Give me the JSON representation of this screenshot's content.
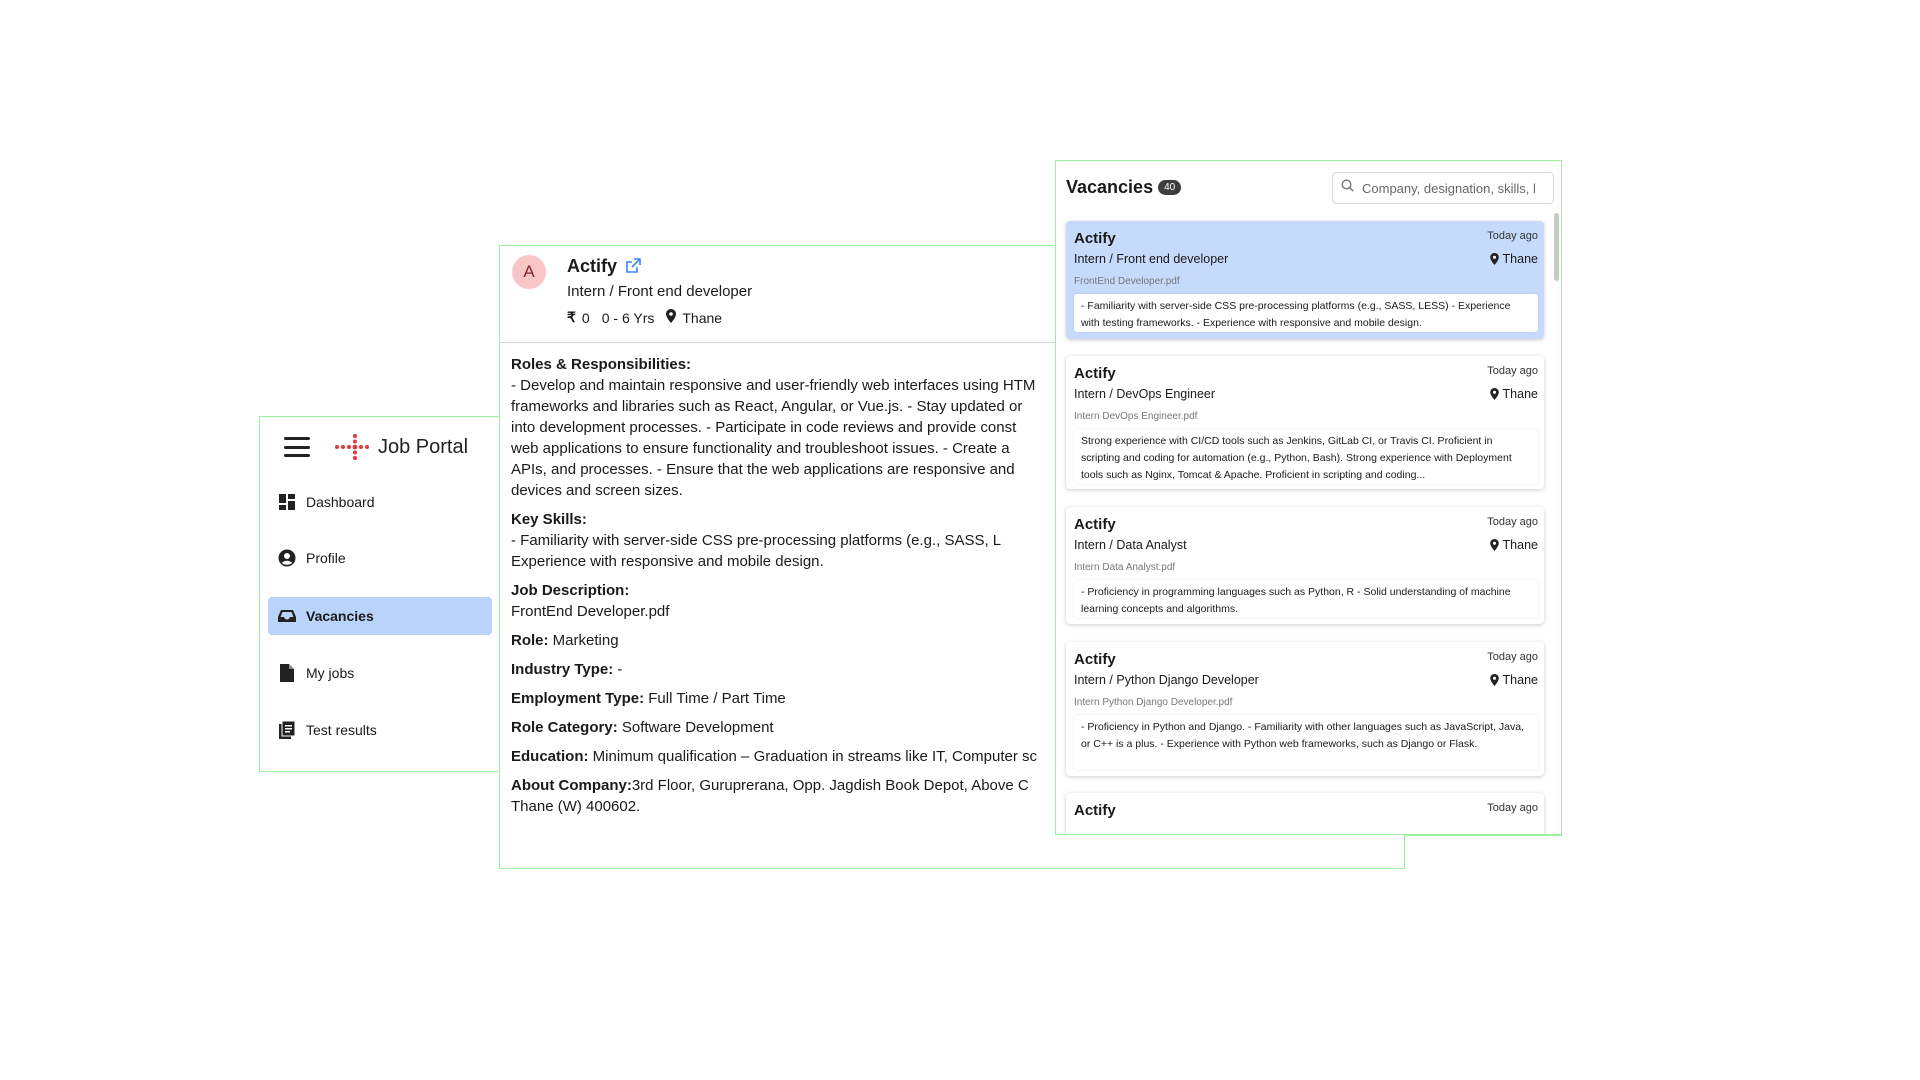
{
  "sidebar": {
    "app_title": "Job Portal",
    "items": [
      {
        "label": "Dashboard",
        "icon": "dashboard-icon"
      },
      {
        "label": "Profile",
        "icon": "account-circle-icon"
      },
      {
        "label": "Vacancies",
        "icon": "inbox-icon",
        "active": true
      },
      {
        "label": "My jobs",
        "icon": "document-icon"
      },
      {
        "label": "Test results",
        "icon": "clipboard-icon"
      }
    ]
  },
  "detail": {
    "avatar_letter": "A",
    "company": "Actify",
    "role": "Intern / Front end developer",
    "salary": "0",
    "experience": "0 - 6 Yrs",
    "location": "Thane",
    "roles_heading": "Roles & Responsibilities:",
    "roles_lines": [
      "- Develop and maintain responsive and user-friendly web interfaces using HTM",
      "frameworks and libraries such as React, Angular, or Vue.js. - Stay updated or",
      "into development processes. - Participate in code reviews and provide const",
      "web applications to ensure functionality and troubleshoot issues. - Create a",
      "APIs, and processes. - Ensure that the web applications are responsive and",
      "devices and screen sizes."
    ],
    "skills_heading": "Key Skills:",
    "skills_lines": [
      "- Familiarity with server-side CSS pre-processing platforms (e.g., SASS, L",
      "Experience with responsive and mobile design."
    ],
    "jd_heading": "Job Description:",
    "jd_file": "FrontEnd Developer.pdf",
    "role_label": "Role:",
    "role_value": "Marketing",
    "industry_label": "Industry Type:",
    "industry_value": "-",
    "employment_label": "Employment Type:",
    "employment_value": "Full Time / Part Time",
    "category_label": "Role Category:",
    "category_value": "Software Development",
    "education_label": "Education:",
    "education_value": "Minimum qualification – Graduation in streams like IT, Computer sc",
    "about_label": "About Company:",
    "about_line1": "3rd Floor, Guruprerana, Opp. Jagdish Book Depot, Above C",
    "about_line2": "Thane (W) 400602."
  },
  "vacancies": {
    "title": "Vacancies",
    "count": "40",
    "search_placeholder": "Company, designation, skills, l",
    "cards": [
      {
        "company": "Actify",
        "date": "Today ago",
        "role": "Intern / Front end developer",
        "location": "Thane",
        "file": "FrontEnd Developer.pdf",
        "desc": "- Familiarity with server-side CSS pre-processing platforms (e.g., SASS, LESS) - Experience with testing frameworks. - Experience with responsive and mobile design.",
        "selected": true
      },
      {
        "company": "Actify",
        "date": "Today ago",
        "role": "Intern / DevOps Engineer",
        "location": "Thane",
        "file": "Intern DevOps Engineer.pdf",
        "desc": "Strong experience with CI/CD tools such as Jenkins, GitLab CI, or Travis CI. Proficient in scripting and coding for automation (e.g., Python, Bash). Strong experience with Deployment tools such as Nginx, Tomcat & Apache. Proficient in scripting and coding..."
      },
      {
        "company": "Actify",
        "date": "Today ago",
        "role": "Intern / Data Analyst",
        "location": "Thane",
        "file": "Intern Data Analyst.pdf",
        "desc": "- Proficiency in programming languages such as Python, R - Solid understanding of machine learning concepts and algorithms."
      },
      {
        "company": "Actify",
        "date": "Today ago",
        "role": "Intern / Python Django Developer",
        "location": "Thane",
        "file": "Intern Python Django Developer.pdf",
        "desc": "- Proficiency in Python and Django. - Familiarity with other languages such as JavaScript, Java, or C++ is a plus. - Experience with Python web frameworks, such as Django or Flask."
      },
      {
        "company": "Actify",
        "date": "Today ago"
      }
    ]
  }
}
